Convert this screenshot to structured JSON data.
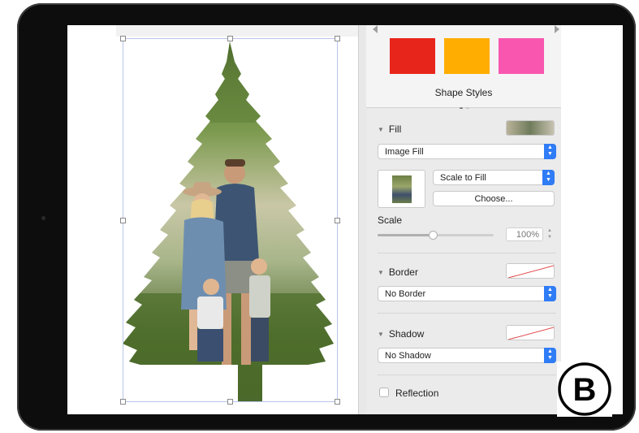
{
  "inspector": {
    "shape_styles": {
      "label": "Shape Styles",
      "swatches": [
        {
          "name": "red",
          "color": "#e8251b"
        },
        {
          "name": "orange",
          "color": "#ffad00"
        },
        {
          "name": "pink",
          "color": "#f956b0"
        }
      ]
    },
    "fill": {
      "heading": "Fill",
      "type_value": "Image Fill",
      "scale_mode_value": "Scale to Fill",
      "choose_label": "Choose...",
      "scale_label": "Scale",
      "scale_value": "100%"
    },
    "border": {
      "heading": "Border",
      "value": "No Border"
    },
    "shadow": {
      "heading": "Shadow",
      "value": "No Shadow"
    },
    "reflection": {
      "label": "Reflection",
      "checked": false
    }
  },
  "logo": {
    "letter": "B"
  }
}
